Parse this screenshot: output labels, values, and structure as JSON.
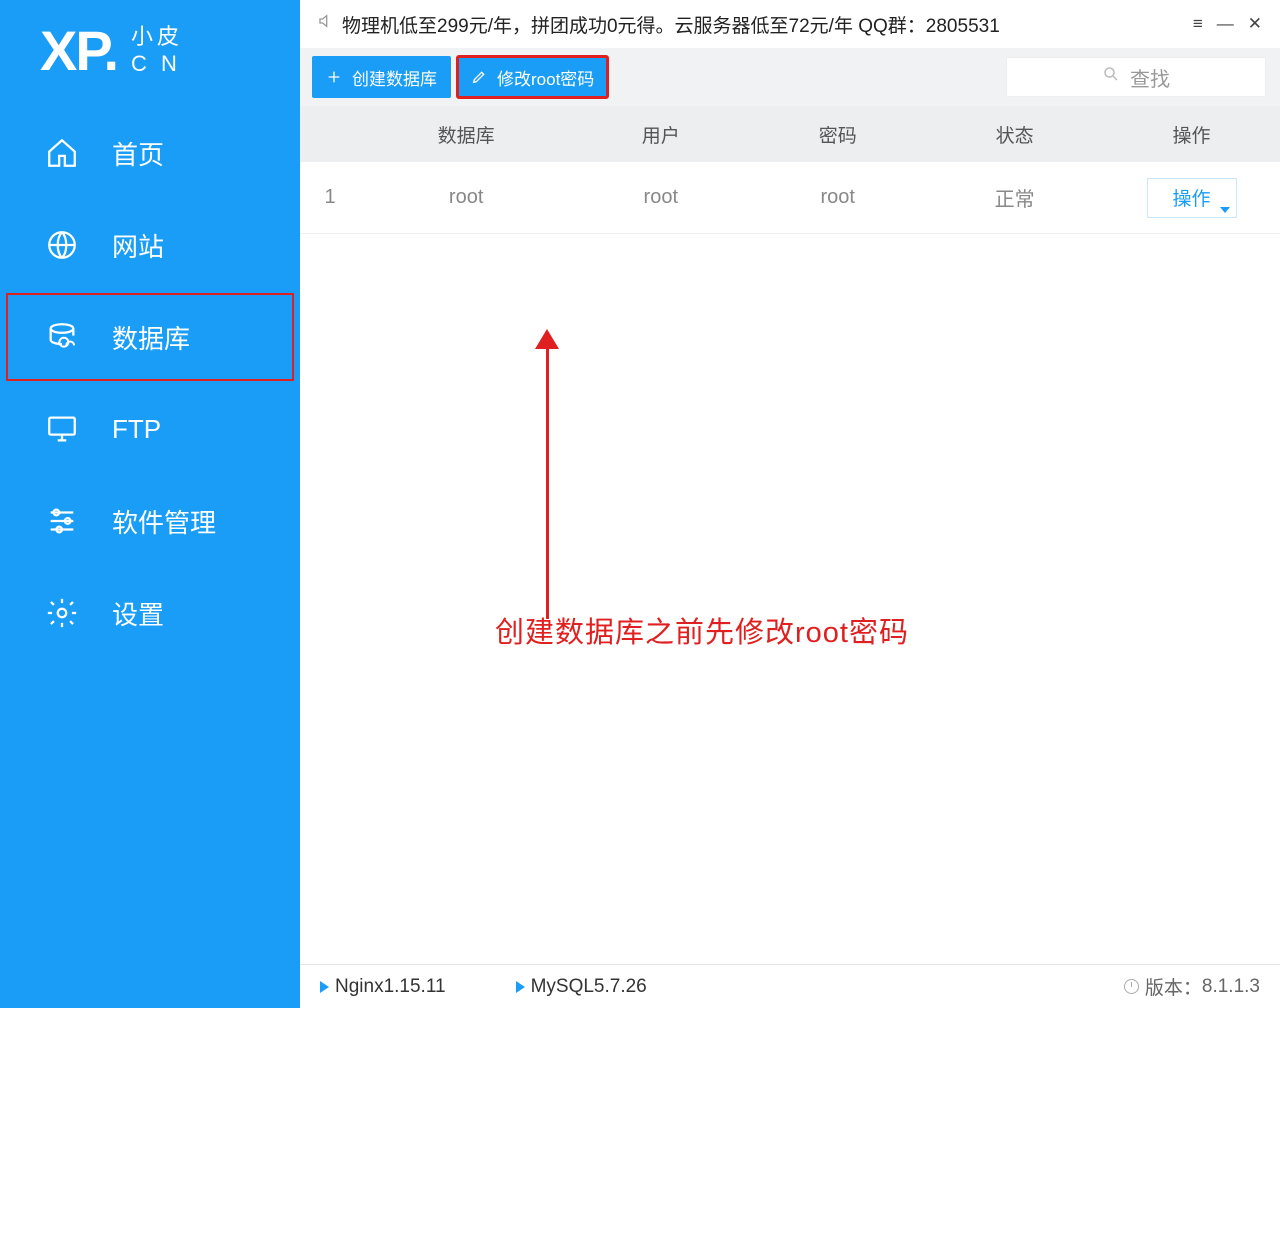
{
  "logo": {
    "main": "XP.",
    "sub1": "小皮",
    "sub2": "C N"
  },
  "sidebar": {
    "items": [
      {
        "label": "首页"
      },
      {
        "label": "网站"
      },
      {
        "label": "数据库"
      },
      {
        "label": "FTP"
      },
      {
        "label": "软件管理"
      },
      {
        "label": "设置"
      }
    ]
  },
  "titlebar": {
    "promo": "物理机低至299元/年，拼团成功0元得。云服务器低至72元/年  QQ群：2805531"
  },
  "toolbar": {
    "create_label": "创建数据库",
    "modify_root_label": "修改root密码",
    "search_placeholder": "查找"
  },
  "table": {
    "headers": {
      "db": "数据库",
      "user": "用户",
      "pwd": "密码",
      "status": "状态",
      "op": "操作"
    },
    "rows": [
      {
        "num": "1",
        "db": "root",
        "user": "root",
        "pwd": "root",
        "status": "正常",
        "op": "操作"
      }
    ]
  },
  "annotation": {
    "text": "创建数据库之前先修改root密码"
  },
  "statusbar": {
    "nginx": "Nginx1.15.11",
    "mysql": "MySQL5.7.26",
    "version_label": "版本：",
    "version": "8.1.1.3"
  }
}
